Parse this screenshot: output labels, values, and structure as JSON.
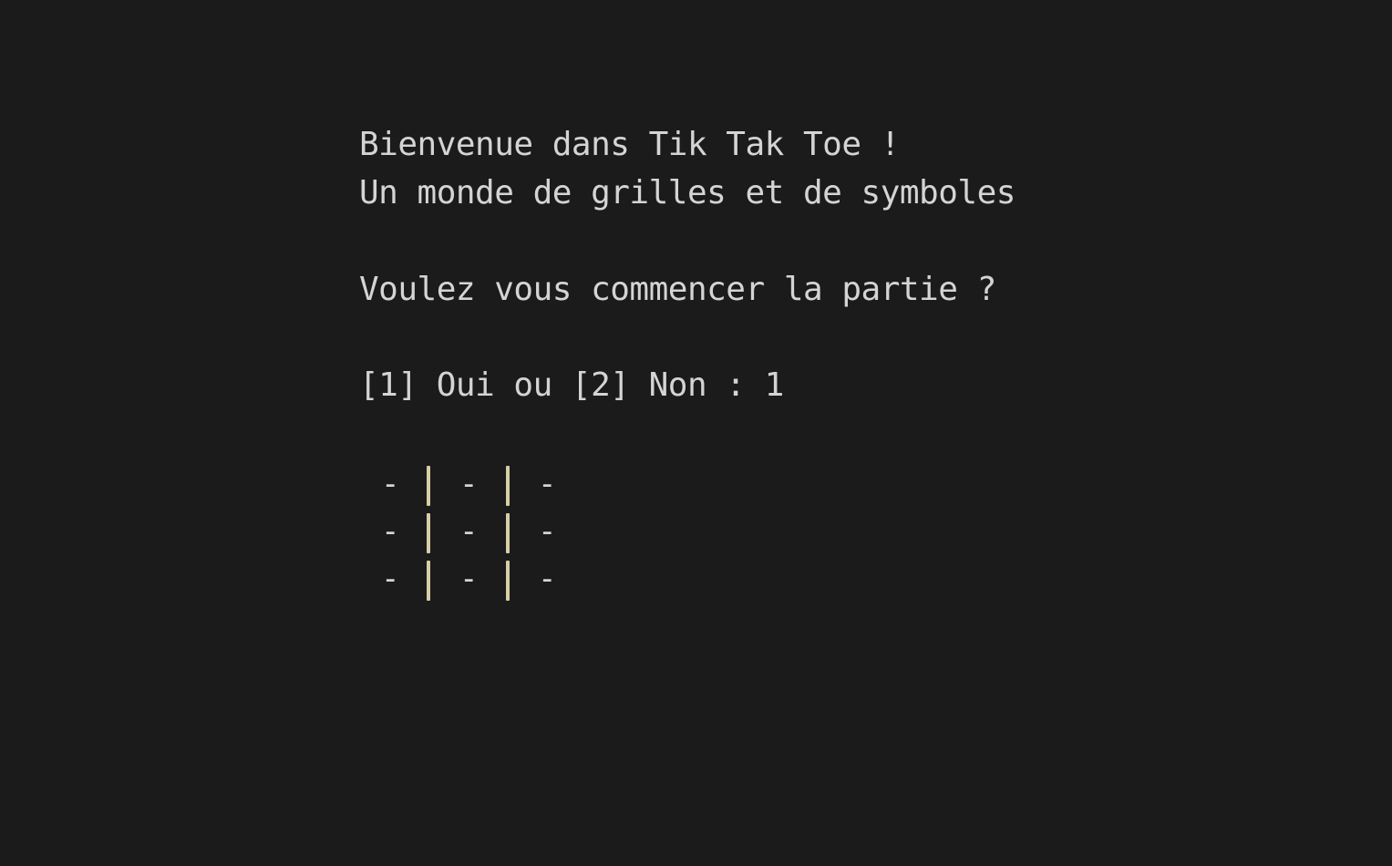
{
  "console": {
    "welcome": "Bienvenue dans Tik Tak Toe !",
    "subtitle": "Un monde de grilles et de symboles",
    "question": "Voulez vous commencer la partie ?",
    "prompt": "[1] Oui ou [2] Non : 1"
  },
  "board": {
    "rows": [
      [
        "-",
        "-",
        "-"
      ],
      [
        "-",
        "-",
        "-"
      ],
      [
        "-",
        "-",
        "-"
      ]
    ],
    "separator_color": "#d6cfa6"
  },
  "colors": {
    "background": "#1b1b1b",
    "text": "#d4d4d4"
  }
}
